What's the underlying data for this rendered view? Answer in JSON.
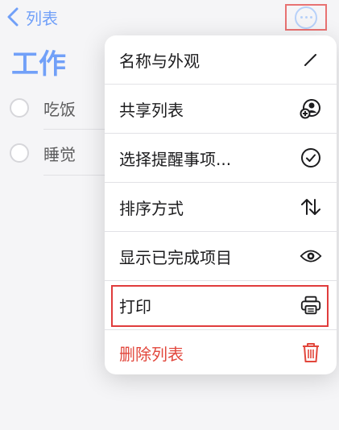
{
  "nav": {
    "back_label": "列表"
  },
  "page": {
    "title": "工作"
  },
  "tasks": [
    {
      "text": "吃饭"
    },
    {
      "text": "睡觉"
    }
  ],
  "menu": {
    "items": [
      {
        "label": "名称与外观",
        "icon": "pencil-icon"
      },
      {
        "label": "共享列表",
        "icon": "person-add-icon"
      },
      {
        "label": "选择提醒事项...",
        "icon": "checkmark-circle-icon"
      },
      {
        "label": "排序方式",
        "icon": "sort-arrows-icon"
      },
      {
        "label": "显示已完成项目",
        "icon": "eye-icon"
      },
      {
        "label": "打印",
        "icon": "printer-icon"
      },
      {
        "label": "删除列表",
        "icon": "trash-icon"
      }
    ]
  },
  "colors": {
    "accent": "#3b7cf6",
    "danger": "#e2473c",
    "highlight": "#e03c3c"
  }
}
